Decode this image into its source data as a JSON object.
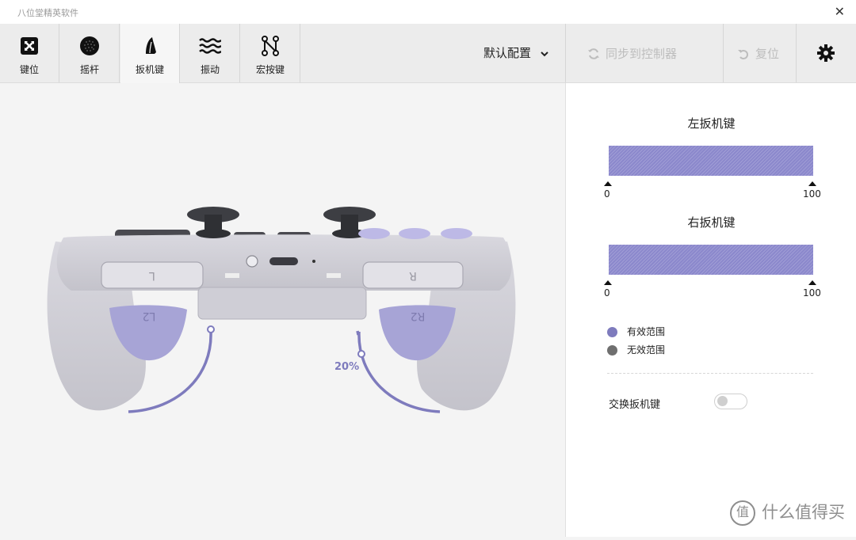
{
  "window": {
    "title": "八位堂精英软件",
    "close_glyph": "✕"
  },
  "tabs": [
    {
      "label": "键位",
      "icon": "button-mapping-icon"
    },
    {
      "label": "摇杆",
      "icon": "joystick-icon"
    },
    {
      "label": "扳机键",
      "icon": "trigger-icon",
      "active": true
    },
    {
      "label": "振动",
      "icon": "vibration-icon"
    },
    {
      "label": "宏按键",
      "icon": "macro-icon"
    }
  ],
  "profile": {
    "label": "默认配置"
  },
  "actions": {
    "sync_label": "同步到控制器",
    "reset_label": "复位"
  },
  "controller": {
    "trigger_percent_label": "20%",
    "left_trigger_percent": 20,
    "right_trigger_percent": 20
  },
  "side": {
    "left_trigger": {
      "title": "左扳机键",
      "min_label": "0",
      "max_label": "100",
      "range": [
        0,
        100
      ]
    },
    "right_trigger": {
      "title": "右扳机键",
      "min_label": "0",
      "max_label": "100",
      "range": [
        0,
        100
      ]
    },
    "legend": {
      "valid": "有效范围",
      "invalid": "无效范围"
    },
    "swap": {
      "label": "交换扳机键",
      "enabled": false
    }
  },
  "colors": {
    "accent": "#7e7bbd",
    "bar": "#8b88cc",
    "invalid": "#6f6f6f",
    "trigger_button": "#a7a4d6"
  },
  "watermark": {
    "badge": "值",
    "text": "什么值得买"
  }
}
